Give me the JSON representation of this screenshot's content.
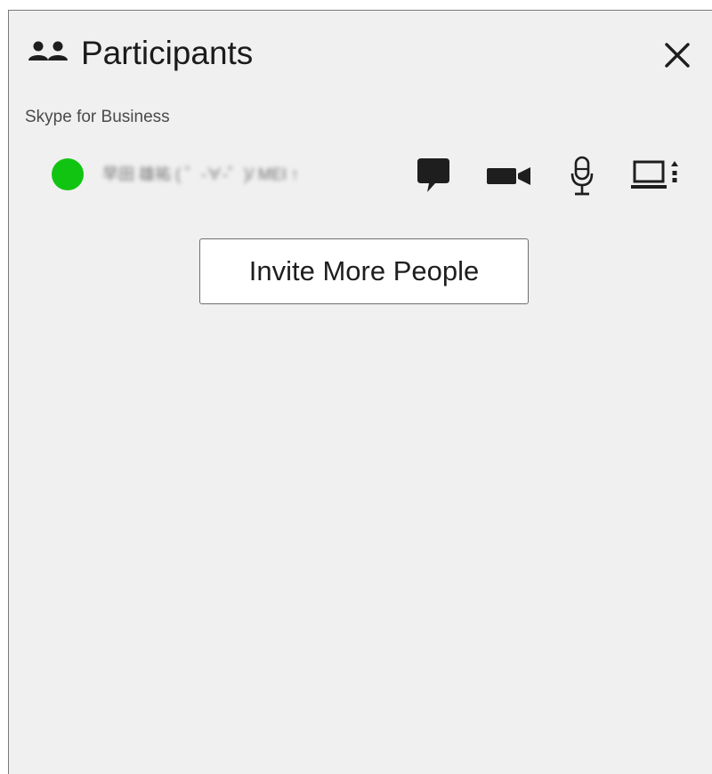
{
  "header": {
    "title": "Participants",
    "people_icon": "people-icon",
    "close_icon": "close-icon"
  },
  "section": {
    "label": "Skype for Business"
  },
  "participant": {
    "name": "早田 雄祐 ( ゜-∀-゜)/ MEI ↑",
    "presence": "available",
    "presence_color": "#12c412",
    "actions": [
      "chat-icon",
      "video-icon",
      "microphone-icon",
      "screen-share-icon"
    ]
  },
  "invite_button": {
    "label": "Invite More People"
  },
  "colors": {
    "panel_background": "#f0f0f0",
    "button_background": "#ffffff",
    "icon_color": "#1e1e1e"
  }
}
